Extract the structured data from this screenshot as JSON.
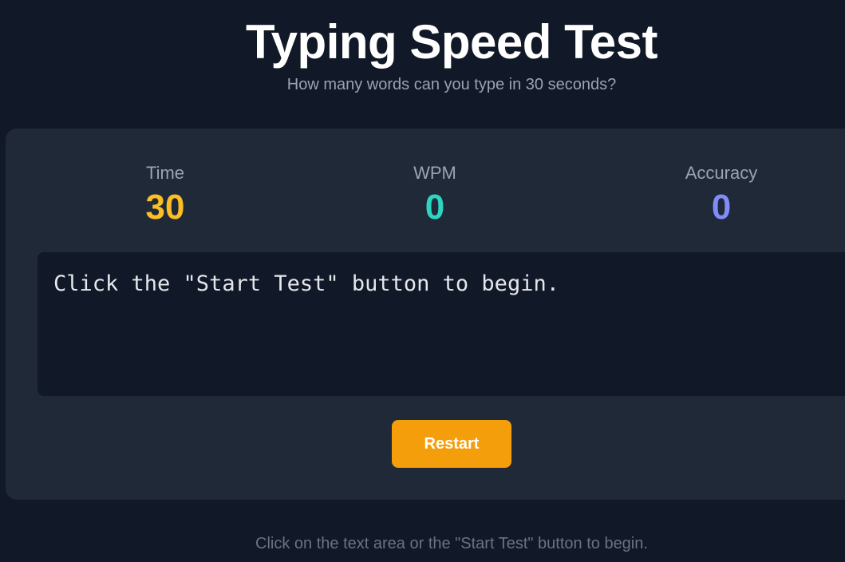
{
  "header": {
    "title": "Typing Speed Test",
    "subtitle": "How many words can you type in 30 seconds?"
  },
  "stats": {
    "time": {
      "label": "Time",
      "value": "30",
      "color": "#fbbf24"
    },
    "wpm": {
      "label": "WPM",
      "value": "0",
      "color": "#2dd4bf"
    },
    "accuracy": {
      "label": "Accuracy",
      "value": "0",
      "color": "#818cf8"
    }
  },
  "text_display": {
    "text": "Click the \"Start Test\" button to begin."
  },
  "restart_button": {
    "label": "Restart",
    "color": "#f59e0b"
  },
  "footer": {
    "hint": "Click on the text area or the \"Start Test\" button to begin."
  }
}
